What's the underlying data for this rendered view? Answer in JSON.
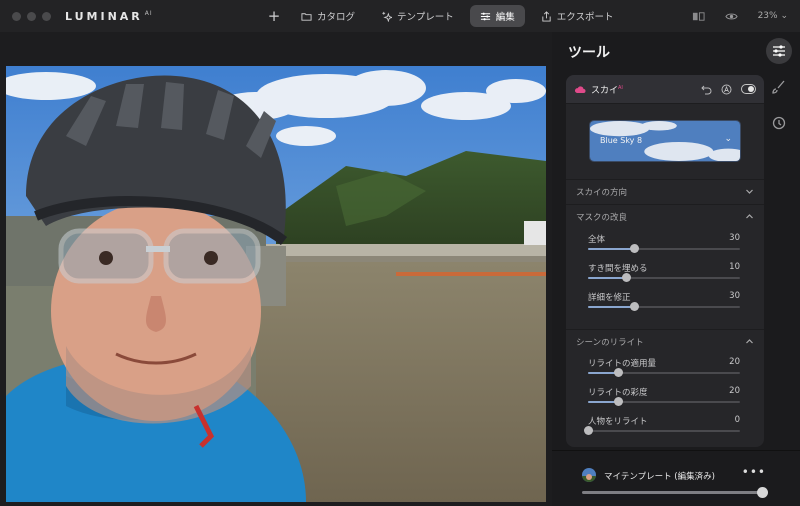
{
  "app": {
    "logo": "LUMINAR",
    "logo_suffix": "AI"
  },
  "topnav": {
    "items": [
      {
        "label": "カタログ",
        "icon": "folder-icon"
      },
      {
        "label": "テンプレート",
        "icon": "sparkle-icon"
      },
      {
        "label": "編集",
        "icon": "sliders-icon",
        "active": true
      },
      {
        "label": "エクスポート",
        "icon": "share-icon"
      }
    ],
    "zoom": "23%"
  },
  "panel": {
    "title": "ツール",
    "tool": {
      "name": "スカイ",
      "badge": "AI",
      "sky_selection": "Blue Sky 8",
      "sections": [
        {
          "label": "スカイの方向",
          "expanded": false
        },
        {
          "label": "マスクの改良",
          "expanded": true,
          "sliders": [
            {
              "label": "全体",
              "value": 30,
              "max": 100
            },
            {
              "label": "すき間を埋める",
              "value": 10,
              "max": 40
            },
            {
              "label": "詳細を修正",
              "value": 30,
              "max": 100
            }
          ]
        },
        {
          "label": "シーンのリライト",
          "expanded": true,
          "sliders": [
            {
              "label": "リライトの適用量",
              "value": 20,
              "max": 100
            },
            {
              "label": "リライトの彩度",
              "value": 20,
              "max": 100
            },
            {
              "label": "人物をリライト",
              "value": 0,
              "max": 100
            }
          ]
        }
      ]
    },
    "preset": {
      "name": "マイテンプレート (編集済み)",
      "amount": 100,
      "more": "•••"
    }
  },
  "colors": {
    "accent": "#8aa6cf",
    "ai_badge": "#e04a8a",
    "active_nav": "#49494c"
  }
}
